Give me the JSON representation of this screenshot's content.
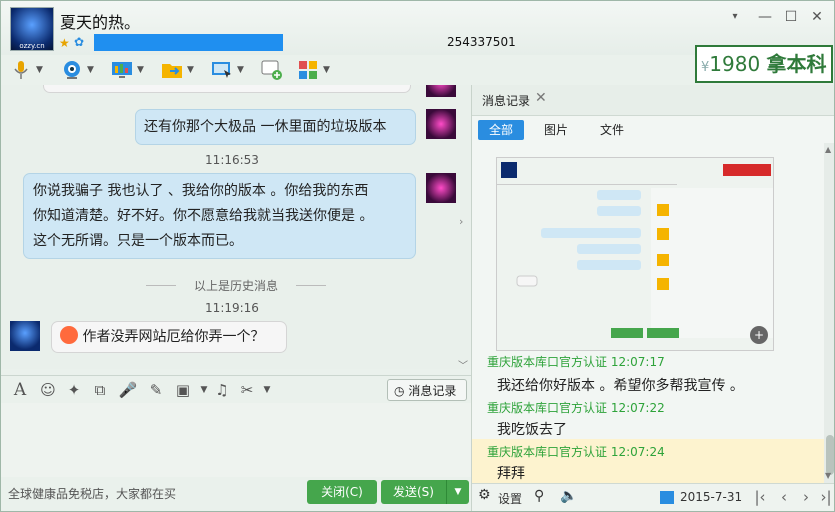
{
  "window": {
    "nickname": "夏天的热。",
    "qq_number": "254337501",
    "avatar_text": "ozzy.cn"
  },
  "promo": {
    "prefix": "¥",
    "number": "1980",
    "text": "拿本科"
  },
  "chat": {
    "bubble_right_1": "还有你那个大极品 一休里面的垃圾版本",
    "time_1": "11:16:53",
    "bubble_right_2_lines": [
      "你说我骗子 我也认了 、我给你的版本 。你给我的东西",
      "你知道清楚。好不好。你不愿意给我就当我送你便是 。",
      "这个无所谓。只是一个版本而已。"
    ],
    "history_sep": "以上是历史消息",
    "time_2": "11:19:16",
    "bubble_left_1": "作者没弄网站厄给你弄一个？"
  },
  "input_toolbar": {
    "msg_record_label": "消息记录"
  },
  "footer": {
    "ad_text": "全球健康品免税店，大家都在买",
    "close_label": "关闭(C)",
    "send_label": "发送(S)"
  },
  "right_panel": {
    "tab_title": "消息记录",
    "filters": [
      "全部",
      "图片",
      "文件"
    ],
    "records": [
      {
        "sender": "重庆版本库口官方认证",
        "time": "12:07:17",
        "text": "我还给你好版本 。希望你多帮我宣传 。"
      },
      {
        "sender": "重庆版本库口官方认证",
        "time": "12:07:22",
        "text": "我吃饭去了"
      },
      {
        "sender": "重庆版本库口官方认证",
        "time": "12:07:24",
        "text": "拜拜"
      }
    ],
    "settings_label": "设置",
    "date": "2015-7-31"
  },
  "colors": {
    "accent": "#2a8de0",
    "send_green": "#45a64c",
    "sender_green": "#2ea33a",
    "highlight": "#fdf3cf"
  }
}
